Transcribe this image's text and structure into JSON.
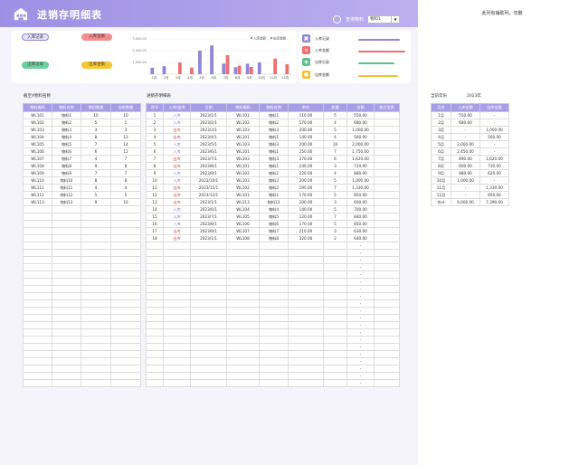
{
  "header": {
    "title": "进销存明细表",
    "search_label": "查询物料",
    "search_value": "物料1",
    "side_note": "此列有辅助列，勿删"
  },
  "kpi": {
    "left": [
      "入库记录",
      "入库金额",
      "出库记录",
      "出库金额"
    ],
    "right": [
      "入库记录",
      "入库金额",
      "出库记录",
      "出库金额"
    ],
    "icons": [
      "inbox-icon",
      "money-bag-icon",
      "outbox-icon",
      "coins-icon"
    ],
    "colors": {
      "purple": "#8f86d8",
      "red": "#ee6f6f",
      "green": "#5fbf8f",
      "yellow": "#f2c12e"
    }
  },
  "chart_data": {
    "type": "bar",
    "categories": [
      "1月",
      "2月",
      "3月",
      "4月",
      "5月",
      "6月",
      "7月",
      "8月",
      "9月",
      "10月",
      "11月",
      "12月"
    ],
    "series": [
      {
        "name": "入库金额",
        "color": "#8f86d8",
        "values": [
          550,
          680,
          0,
          0,
          2000,
          2450,
          890,
          600,
          880,
          1000,
          0,
          0
        ]
      },
      {
        "name": "出库金额",
        "color": "#ee6f6f",
        "values": [
          0,
          0,
          1000,
          560,
          0,
          0,
          1620,
          720,
          620,
          0,
          1330,
          850
        ]
      }
    ],
    "ylim": [
      0,
      3000
    ],
    "yticks": [
      "3,000.00",
      "2,000.00",
      "1,000.00"
    ],
    "legend": "top-right"
  },
  "inventory": {
    "caption": "截至X物料名称",
    "headers": [
      "物料编码",
      "物料名称",
      "期初数量",
      "当前数量"
    ],
    "rows": [
      [
        "WL101",
        "物料1",
        "10",
        "10"
      ],
      [
        "WL102",
        "物料2",
        "5",
        "1"
      ],
      [
        "WL103",
        "物料3",
        "3",
        "3"
      ],
      [
        "WL104",
        "物料4",
        "8",
        "13"
      ],
      [
        "WL105",
        "物料5",
        "7",
        "14"
      ],
      [
        "WL106",
        "物料6",
        "6",
        "12"
      ],
      [
        "WL107",
        "物料7",
        "4",
        "7"
      ],
      [
        "WL108",
        "物料8",
        "9",
        "8"
      ],
      [
        "WL109",
        "物料9",
        "7",
        "7"
      ],
      [
        "WL110",
        "物料10",
        "8",
        "8"
      ],
      [
        "WL111",
        "物料11",
        "4",
        "4"
      ],
      [
        "WL112",
        "物料12",
        "5",
        "5"
      ],
      [
        "WL113",
        "物料13",
        "9",
        "10"
      ]
    ],
    "blank_rows": 25
  },
  "ledger": {
    "caption": "进销存明细表",
    "headers": [
      "序号",
      "入库/出库",
      "日期",
      "物料编码",
      "物料名称",
      "单价",
      "数量",
      "金额",
      "备注信息"
    ],
    "rows": [
      [
        "1",
        "入库",
        "2023/1/1",
        "WL101",
        "物料1",
        "110.00",
        "5",
        "550.00"
      ],
      [
        "2",
        "入库",
        "2023/2/1",
        "WL102",
        "物料2",
        "170.00",
        "4",
        "680.00"
      ],
      [
        "3",
        "出库",
        "2023/3/1",
        "WL103",
        "物料3",
        "200.00",
        "5",
        "1,000.00"
      ],
      [
        "4",
        "出库",
        "2023/4/1",
        "WL101",
        "物料1",
        "140.00",
        "4",
        "560.00"
      ],
      [
        "5",
        "入库",
        "2023/5/1",
        "WL103",
        "物料3",
        "200.00",
        "10",
        "2,000.00"
      ],
      [
        "6",
        "入库",
        "2023/6/1",
        "WL101",
        "物料1",
        "250.00",
        "7",
        "1,750.00"
      ],
      [
        "7",
        "出库",
        "2023/7/1",
        "WL103",
        "物料3",
        "270.00",
        "6",
        "1,620.00"
      ],
      [
        "8",
        "出库",
        "2023/8/1",
        "WL101",
        "物料1",
        "240.00",
        "3",
        "720.00"
      ],
      [
        "9",
        "入库",
        "2023/9/1",
        "WL102",
        "物料2",
        "220.00",
        "4",
        "880.00"
      ],
      [
        "10",
        "入库",
        "2023/10/1",
        "WL103",
        "物料3",
        "200.00",
        "5",
        "1,000.00"
      ],
      [
        "11",
        "出库",
        "2023/11/1",
        "WL102",
        "物料2",
        "190.00",
        "7",
        "1,330.00"
      ],
      [
        "12",
        "出库",
        "2023/12/1",
        "WL101",
        "物料1",
        "170.00",
        "5",
        "850.00"
      ],
      [
        "13",
        "出库",
        "2023/1/1",
        "WL113",
        "物料13",
        "200.00",
        "3",
        "600.00"
      ],
      [
        "14",
        "入库",
        "2023/6/1",
        "WL104",
        "物料4",
        "140.00",
        "5",
        "700.00"
      ],
      [
        "15",
        "入库",
        "2023/7/1",
        "WL105",
        "物料5",
        "120.00",
        "7",
        "840.00"
      ],
      [
        "16",
        "入库",
        "2023/8/1",
        "WL106",
        "物料6",
        "170.00",
        "5",
        "850.00"
      ],
      [
        "17",
        "出库",
        "2023/9/1",
        "WL107",
        "物料7",
        "210.00",
        "3",
        "630.00"
      ],
      [
        "18",
        "出库",
        "2023/1/1",
        "WL108",
        "物料8",
        "320.00",
        "2",
        "640.00"
      ]
    ],
    "blank_rows": 20,
    "dash": "-"
  },
  "monthly": {
    "year_label": "当前年份",
    "year": "2023年",
    "headers": [
      "月份",
      "入库金额",
      "出库金额"
    ],
    "rows": [
      [
        "1月",
        "550.00",
        "-"
      ],
      [
        "2月",
        "680.00",
        "-"
      ],
      [
        "3月",
        "-",
        "1,000.00"
      ],
      [
        "4月",
        "-",
        "560.00"
      ],
      [
        "5月",
        "2,000.00",
        "-"
      ],
      [
        "6月",
        "2,450.00",
        "-"
      ],
      [
        "7月",
        "890.00",
        "1,620.00"
      ],
      [
        "8月",
        "600.00",
        "720.00"
      ],
      [
        "9月",
        "880.00",
        "620.00"
      ],
      [
        "10月",
        "1,000.00",
        "-"
      ],
      [
        "11月",
        "-",
        "1,330.00"
      ],
      [
        "12月",
        "-",
        "850.00"
      ],
      [
        "合计",
        "9,000.00",
        "7,390.00"
      ]
    ]
  }
}
